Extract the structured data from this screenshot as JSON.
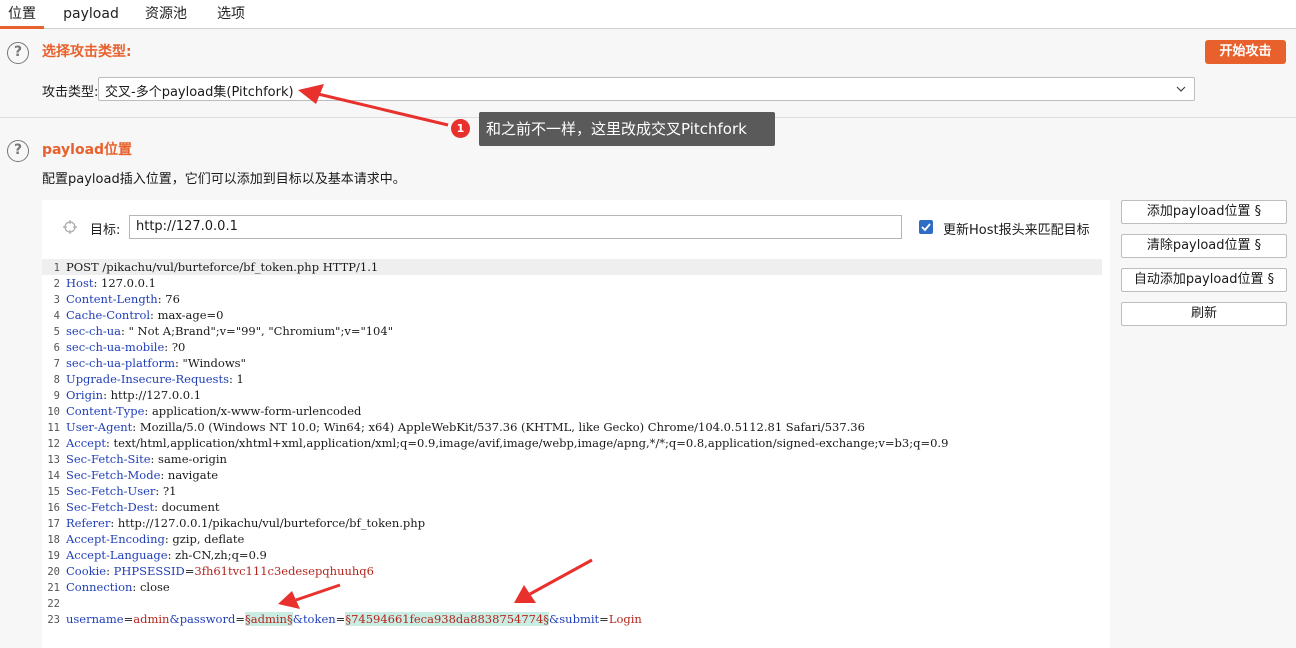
{
  "tabs": [
    {
      "label": "位置",
      "active": true
    },
    {
      "label": "payload",
      "active": false
    },
    {
      "label": "资源池",
      "active": false
    },
    {
      "label": "选项",
      "active": false
    }
  ],
  "attack_type": {
    "title": "选择攻击类型:",
    "label": "攻击类型:",
    "value": "交叉-多个payload集(Pitchfork)",
    "start_button": "开始攻击"
  },
  "annotation": {
    "number": "1",
    "text": "和之前不一样，这里改成交叉Pitchfork"
  },
  "positions": {
    "title": "payload位置",
    "description": "配置payload插入位置，它们可以添加到目标以及基本请求中。",
    "target_label": "目标:",
    "target_value": "http://127.0.0.1",
    "update_host_label": "更新Host报头来匹配目标",
    "update_host_checked": true
  },
  "side_buttons": {
    "add": "添加payload位置 §",
    "clear": "清除payload位置 §",
    "auto": "自动添加payload位置 §",
    "refresh": "刷新"
  },
  "request": {
    "request_line": "POST /pikachu/vul/burteforce/bf_token.php HTTP/1.1",
    "headers": [
      {
        "name": "Host",
        "value": "127.0.0.1"
      },
      {
        "name": "Content-Length",
        "value": "76"
      },
      {
        "name": "Cache-Control",
        "value": "max-age=0"
      },
      {
        "name": "sec-ch-ua",
        "value": "\" Not A;Brand\";v=\"99\", \"Chromium\";v=\"104\""
      },
      {
        "name": "sec-ch-ua-mobile",
        "value": "?0"
      },
      {
        "name": "sec-ch-ua-platform",
        "value": "\"Windows\""
      },
      {
        "name": "Upgrade-Insecure-Requests",
        "value": "1"
      },
      {
        "name": "Origin",
        "value": "http://127.0.0.1"
      },
      {
        "name": "Content-Type",
        "value": "application/x-www-form-urlencoded"
      },
      {
        "name": "User-Agent",
        "value": "Mozilla/5.0 (Windows NT 10.0; Win64; x64) AppleWebKit/537.36 (KHTML, like Gecko) Chrome/104.0.5112.81 Safari/537.36"
      },
      {
        "name": "Accept",
        "value": "text/html,application/xhtml+xml,application/xml;q=0.9,image/avif,image/webp,image/apng,*/*;q=0.8,application/signed-exchange;v=b3;q=0.9"
      },
      {
        "name": "Sec-Fetch-Site",
        "value": "same-origin"
      },
      {
        "name": "Sec-Fetch-Mode",
        "value": "navigate"
      },
      {
        "name": "Sec-Fetch-User",
        "value": "?1"
      },
      {
        "name": "Sec-Fetch-Dest",
        "value": "document"
      },
      {
        "name": "Referer",
        "value": "http://127.0.0.1/pikachu/vul/burteforce/bf_token.php"
      },
      {
        "name": "Accept-Encoding",
        "value": "gzip, deflate"
      },
      {
        "name": "Accept-Language",
        "value": "zh-CN,zh;q=0.9"
      }
    ],
    "cookie_name": "Cookie",
    "cookie_key": "PHPSESSID",
    "cookie_value": "3fh61tvc111c3edesepqhuuhq6",
    "connection_name": "Connection",
    "connection_value": "close",
    "body": {
      "p1_key": "username",
      "p1_val": "admin",
      "p2_key": "&password",
      "p2_mark": "§admin§",
      "p3_key": "&token",
      "p3_mark": "§74594661feca938da8838754774§",
      "p4_key": "&submit",
      "p4_val": "Login"
    }
  },
  "colors": {
    "accent": "#e8612c",
    "arrow": "#e8312c",
    "header_name": "#1f3fb8",
    "param_value": "#b3261e",
    "payload_mark": "#c9ece3"
  }
}
